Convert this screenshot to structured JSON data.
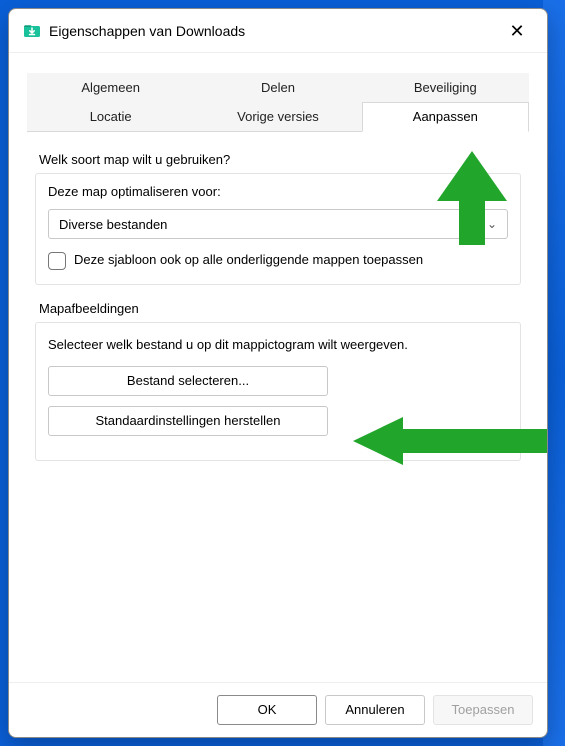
{
  "window_title": "Eigenschappen van Downloads",
  "tabs": {
    "row1": [
      "Algemeen",
      "Delen",
      "Beveiliging"
    ],
    "row2": [
      "Locatie",
      "Vorige versies",
      "Aanpassen"
    ],
    "active": "Aanpassen"
  },
  "sections": {
    "folder_kind": {
      "heading": "Welk soort map wilt u gebruiken?",
      "optimize_label": "Deze map optimaliseren voor:",
      "combo_value": "Diverse bestanden",
      "apply_subfolders": "Deze sjabloon ook op alle onderliggende mappen toepassen"
    },
    "folder_pictures": {
      "heading": "Mapafbeeldingen",
      "instruction": "Selecteer welk bestand u op dit mappictogram wilt weergeven.",
      "choose_file_btn": "Bestand selecteren...",
      "restore_defaults_btn": "Standaardinstellingen herstellen"
    }
  },
  "footer": {
    "ok": "OK",
    "cancel": "Annuleren",
    "apply": "Toepassen"
  },
  "icons": {
    "title_folder": "download-folder-icon",
    "close": "close-icon",
    "chevron_down": "chevron-down-icon"
  },
  "colors": {
    "accent_green": "#22a52b"
  }
}
